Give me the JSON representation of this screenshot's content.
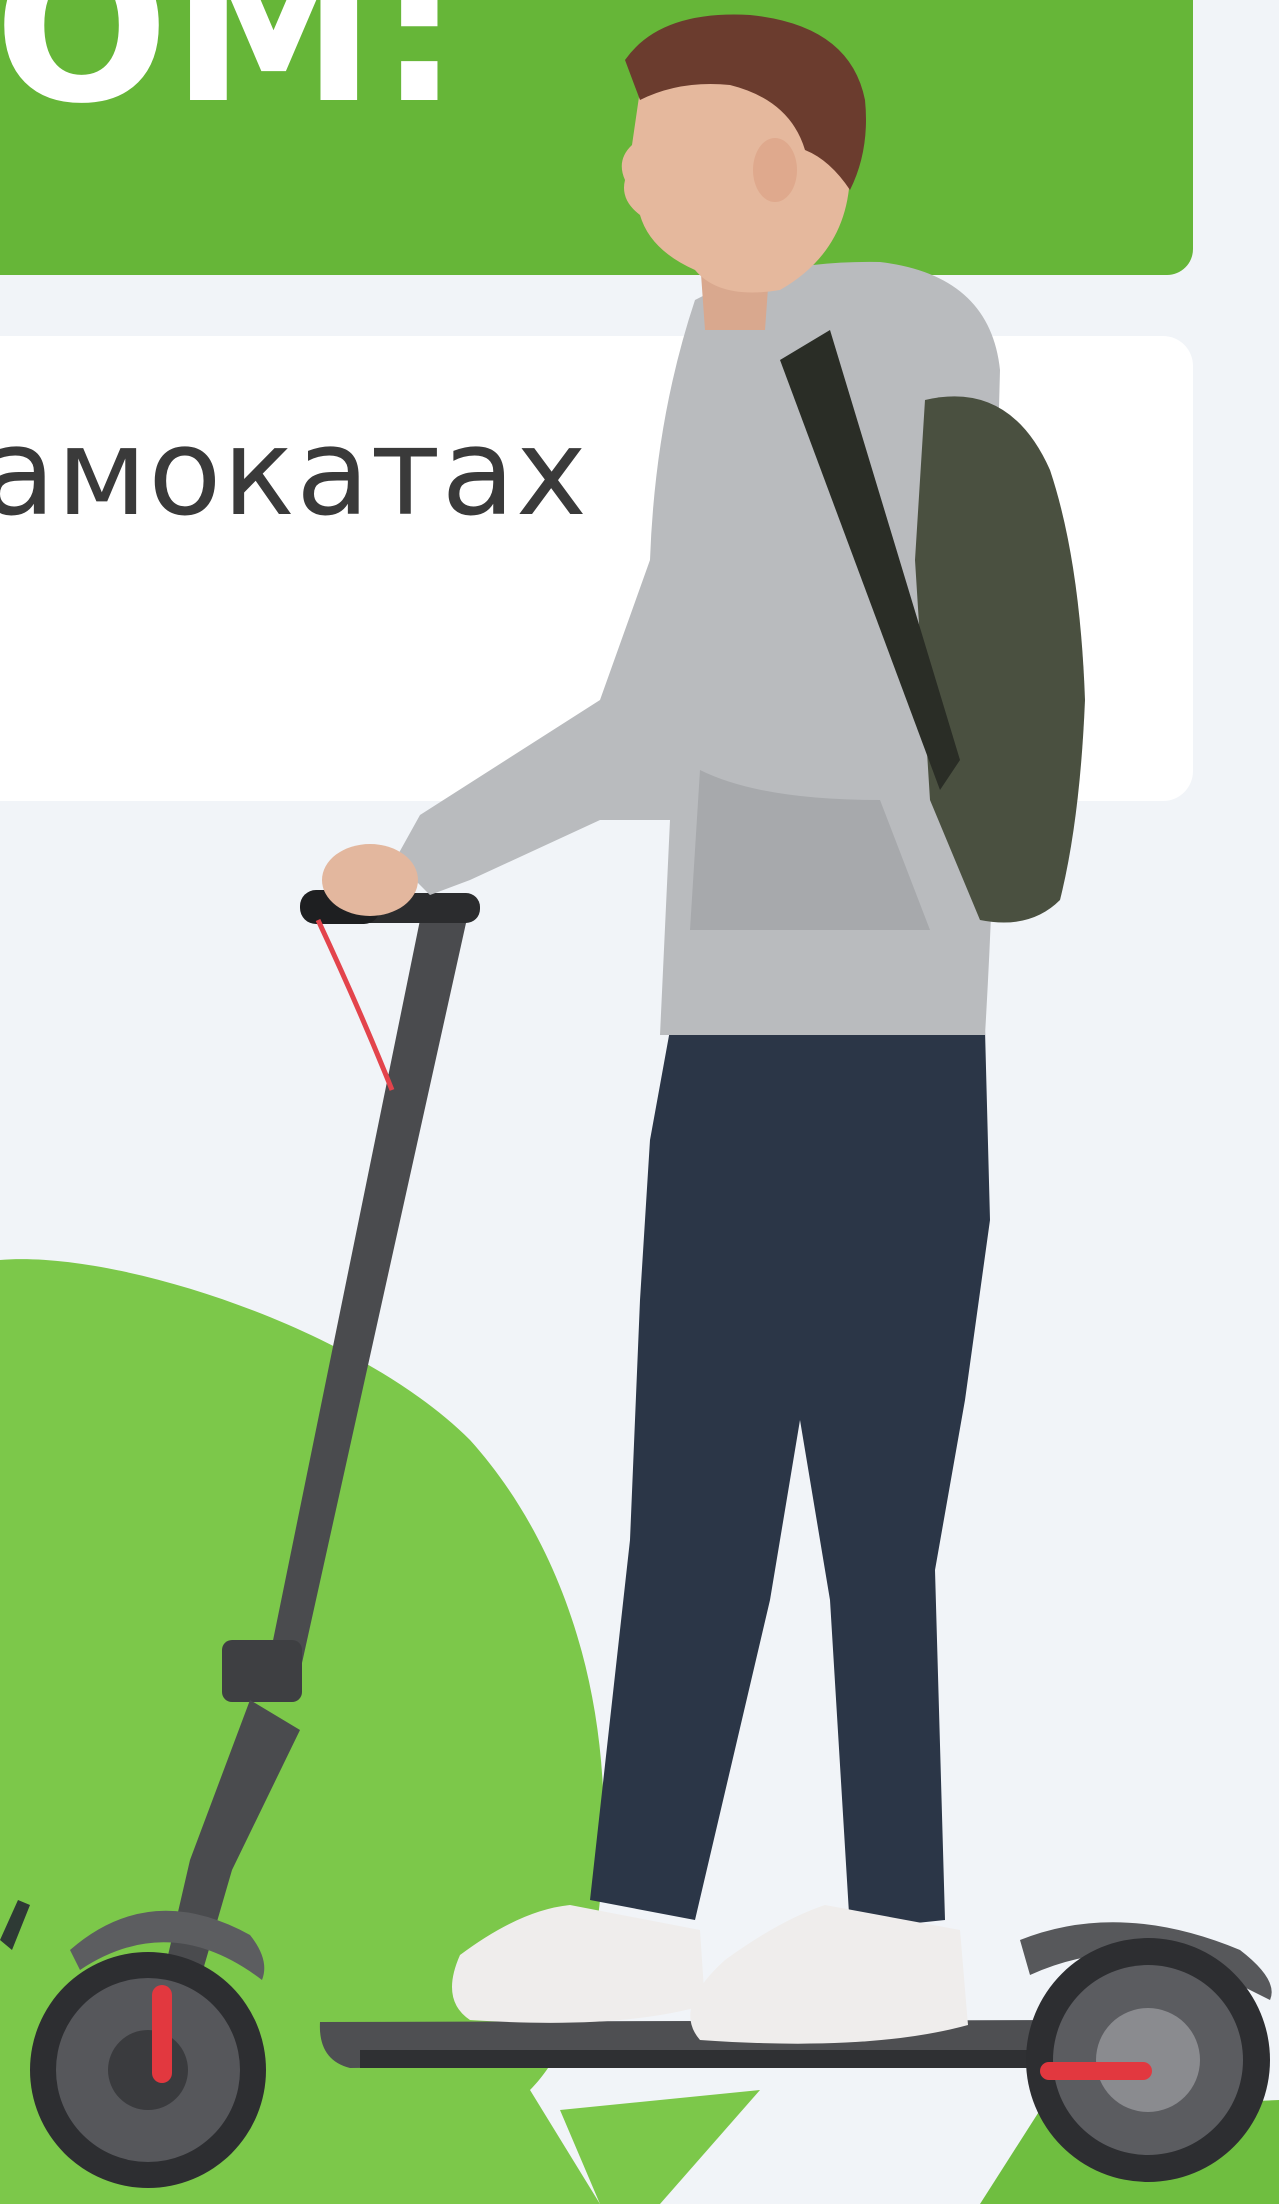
{
  "banner": {
    "heading": "OM:"
  },
  "card": {
    "text": "амокатах"
  },
  "photo": {
    "subject_icon": "person-on-scooter-icon",
    "backpack_icon": "backpack-icon",
    "scooter_icon": "electric-scooter-icon"
  },
  "colors": {
    "background": "#f1f4f8",
    "banner_green": "#66b638",
    "bubble_green": "#7cc84a",
    "card_white": "#ffffff",
    "text_dark": "#3a3a3a"
  }
}
